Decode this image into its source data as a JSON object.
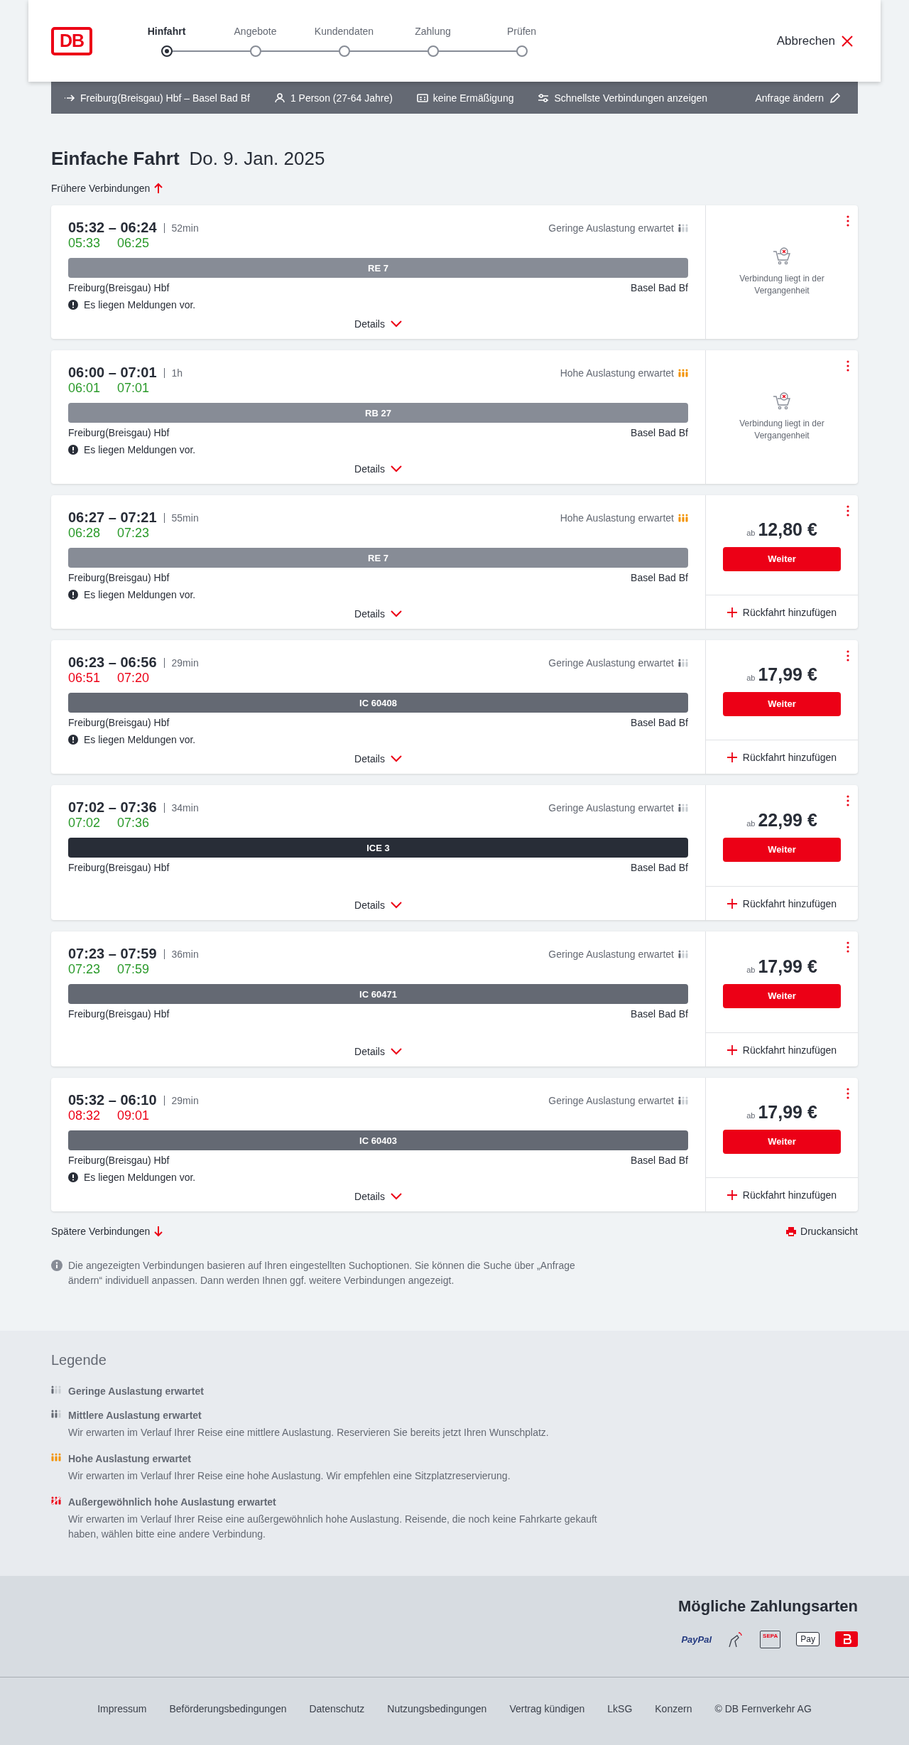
{
  "header": {
    "logo": "DB",
    "steps": [
      {
        "label": "Hinfahrt",
        "selected": true
      },
      {
        "label": "Angebote",
        "selected": false
      },
      {
        "label": "Kundendaten",
        "selected": false
      },
      {
        "label": "Zahlung",
        "selected": false
      },
      {
        "label": "Prüfen",
        "selected": false
      }
    ],
    "cancel": "Abbrechen"
  },
  "summary": [
    {
      "kind": "route",
      "text": "Freiburg(Breisgau) Hbf – Basel Bad Bf"
    },
    {
      "kind": "person",
      "text": "1 Person (27-64 Jahre)"
    },
    {
      "kind": "card",
      "text": "keine Ermäßigung"
    },
    {
      "kind": "filter",
      "text": "Schnellste Verbindungen anzeigen"
    }
  ],
  "change_request": "Anfrage ändern",
  "title": "Einfache Fahrt",
  "date": "Do. 9. Jan. 2025",
  "earlier": "Frühere Verbindungen",
  "connections": [
    {
      "times": "05:32 – 06:24",
      "duration": "52min",
      "occupancy": {
        "kind": "low",
        "text": "Geringe Auslastung erwartet"
      },
      "realtime": [
        {
          "time": "05:33",
          "delayed": false
        },
        {
          "time": "06:25",
          "delayed": false
        }
      ],
      "train": {
        "name": "RE 7",
        "color": "#878c96"
      },
      "from": "Freiburg(Breisgau) Hbf",
      "to": "Basel Bad Bf",
      "message": "Es liegen Meldungen vor.",
      "details": "Details",
      "offer": {
        "kind": "past",
        "text": "Verbindung liegt in der Vergangenheit"
      }
    },
    {
      "times": "06:00 – 07:01",
      "duration": "1h",
      "occupancy": {
        "kind": "high",
        "text": "Hohe Auslastung erwartet"
      },
      "realtime": [
        {
          "time": "06:01",
          "delayed": false
        },
        {
          "time": "07:01",
          "delayed": false
        }
      ],
      "train": {
        "name": "RB 27",
        "color": "#878c96"
      },
      "from": "Freiburg(Breisgau) Hbf",
      "to": "Basel Bad Bf",
      "message": "Es liegen Meldungen vor.",
      "details": "Details",
      "offer": {
        "kind": "past",
        "text": "Verbindung liegt in der Vergangenheit"
      }
    },
    {
      "times": "06:27 – 07:21",
      "duration": "55min",
      "occupancy": {
        "kind": "high",
        "text": "Hohe Auslastung erwartet"
      },
      "realtime": [
        {
          "time": "06:28",
          "delayed": false
        },
        {
          "time": "07:23",
          "delayed": false
        }
      ],
      "train": {
        "name": "RE 7",
        "color": "#878c96"
      },
      "from": "Freiburg(Breisgau) Hbf",
      "to": "Basel Bad Bf",
      "message": "Es liegen Meldungen vor.",
      "details": "Details",
      "offer": {
        "kind": "price",
        "prefix": "ab",
        "price": "12,80 €",
        "button": "Weiter",
        "return": "Rückfahrt hinzufügen"
      }
    },
    {
      "times": "06:23 – 06:56",
      "duration": "29min",
      "occupancy": {
        "kind": "low",
        "text": "Geringe Auslastung erwartet"
      },
      "realtime": [
        {
          "time": "06:51",
          "delayed": true
        },
        {
          "time": "07:20",
          "delayed": true
        }
      ],
      "train": {
        "name": "IC 60408",
        "color": "#646973"
      },
      "from": "Freiburg(Breisgau) Hbf",
      "to": "Basel Bad Bf",
      "message": "Es liegen Meldungen vor.",
      "details": "Details",
      "offer": {
        "kind": "price",
        "prefix": "ab",
        "price": "17,99 €",
        "button": "Weiter",
        "return": "Rückfahrt hinzufügen"
      }
    },
    {
      "times": "07:02 – 07:36",
      "duration": "34min",
      "occupancy": {
        "kind": "low",
        "text": "Geringe Auslastung erwartet"
      },
      "realtime": [
        {
          "time": "07:02",
          "delayed": false
        },
        {
          "time": "07:36",
          "delayed": false
        }
      ],
      "train": {
        "name": "ICE 3",
        "color": "#282d37"
      },
      "from": "Freiburg(Breisgau) Hbf",
      "to": "Basel Bad Bf",
      "details": "Details",
      "offer": {
        "kind": "price",
        "prefix": "ab",
        "price": "22,99 €",
        "button": "Weiter",
        "return": "Rückfahrt hinzufügen"
      }
    },
    {
      "times": "07:23 – 07:59",
      "duration": "36min",
      "occupancy": {
        "kind": "low",
        "text": "Geringe Auslastung erwartet"
      },
      "realtime": [
        {
          "time": "07:23",
          "delayed": false
        },
        {
          "time": "07:59",
          "delayed": false
        }
      ],
      "train": {
        "name": "IC 60471",
        "color": "#646973"
      },
      "from": "Freiburg(Breisgau) Hbf",
      "to": "Basel Bad Bf",
      "details": "Details",
      "offer": {
        "kind": "price",
        "prefix": "ab",
        "price": "17,99 €",
        "button": "Weiter",
        "return": "Rückfahrt hinzufügen"
      }
    },
    {
      "times": "05:32 – 06:10",
      "duration": "29min",
      "occupancy": {
        "kind": "low",
        "text": "Geringe Auslastung erwartet"
      },
      "realtime": [
        {
          "time": "08:32",
          "delayed": true
        },
        {
          "time": "09:01",
          "delayed": true
        }
      ],
      "train": {
        "name": "IC 60403",
        "color": "#646973"
      },
      "from": "Freiburg(Breisgau) Hbf",
      "to": "Basel Bad Bf",
      "message": "Es liegen Meldungen vor.",
      "details": "Details",
      "offer": {
        "kind": "price",
        "prefix": "ab",
        "price": "17,99 €",
        "button": "Weiter",
        "return": "Rückfahrt hinzufügen"
      }
    }
  ],
  "later": "Spätere Verbindungen",
  "print": "Druckansicht",
  "info": "Die angezeigten Verbindungen basieren auf Ihren eingestellten Suchoptionen. Sie können die Suche über „Anfrage ändern“ individuell anpassen. Dann werden Ihnen ggf. weitere Verbindungen angezeigt.",
  "legend": {
    "title": "Legende",
    "items": [
      {
        "kind": "low",
        "title": "Geringe Auslastung erwartet"
      },
      {
        "kind": "medium",
        "title": "Mittlere Auslastung erwartet",
        "text": "Wir erwarten im Verlauf Ihrer Reise eine mittlere Auslastung. Reservieren Sie bereits jetzt Ihren Wunschplatz."
      },
      {
        "kind": "high",
        "title": "Hohe Auslastung erwartet",
        "text": "Wir erwarten im Verlauf Ihrer Reise eine hohe Auslastung. Wir empfehlen eine Sitzplatzreservierung."
      },
      {
        "kind": "extreme",
        "title": "Außergewöhnlich hohe Auslastung erwartet",
        "text": "Wir erwarten im Verlauf Ihrer Reise eine außergewöhnlich hohe Auslastung. Reisende, die noch keine Fahrkarte gekauft haben, wählen bitte eine andere Verbindung."
      }
    ]
  },
  "payment": {
    "title": "Mögliche Zahlungsarten",
    "methods": [
      {
        "kind": "paypal",
        "label": "PayPal"
      },
      {
        "kind": "card"
      },
      {
        "kind": "sepa",
        "label": "SEPA"
      },
      {
        "kind": "applepay",
        "label": "Pay"
      },
      {
        "kind": "db"
      }
    ]
  },
  "footer": [
    "Impressum",
    "Beförderungsbedingungen",
    "Datenschutz",
    "Nutzungsbedingungen",
    "Vertrag kündigen",
    "LkSG",
    "Konzern",
    "© DB Fernverkehr AG"
  ]
}
